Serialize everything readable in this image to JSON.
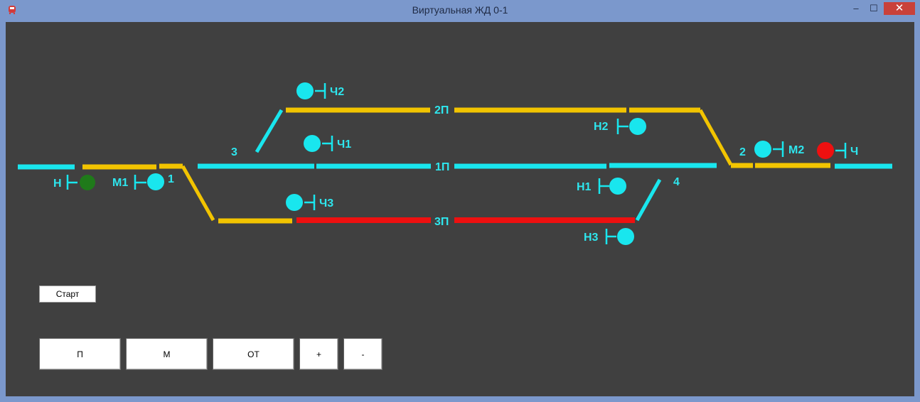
{
  "window": {
    "title": "Виртуальная ЖД 0-1",
    "icon": "train-icon",
    "controls": {
      "minimize": "–",
      "maximize": "☐",
      "close": "✕"
    }
  },
  "colors": {
    "background": "#404040",
    "free": "#19e6ee",
    "route": "#f2c400",
    "occupied": "#ee1010",
    "signal_open": "#1f7a1a",
    "signal_closed": "#ee1010",
    "signal_idle": "#19e6ee"
  },
  "tracks": {
    "p2": "2П",
    "p1": "1П",
    "p3": "3П"
  },
  "switches": {
    "s1": "1",
    "s2": "2",
    "s3": "3",
    "s4": "4"
  },
  "signals": {
    "n": "Н",
    "m1": "М1",
    "ch2": "Ч2",
    "ch1": "Ч1",
    "ch3": "Ч3",
    "n2": "Н2",
    "n1": "Н1",
    "n3": "Н3",
    "m2": "М2",
    "ch": "Ч"
  },
  "buttons": {
    "start": "Старт",
    "p": "П",
    "m": "М",
    "ot": "ОТ",
    "plus": "+",
    "minus": "-"
  }
}
